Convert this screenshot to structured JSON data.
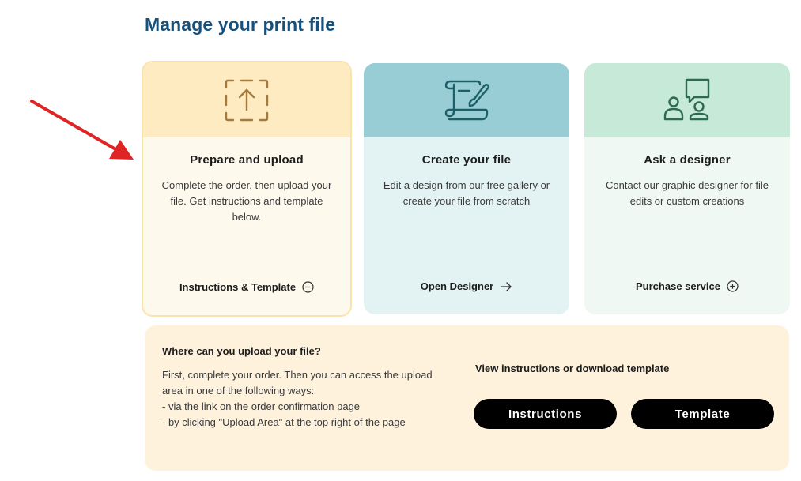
{
  "page": {
    "title": "Manage your print file"
  },
  "colors": {
    "title": "#17507a",
    "arrow": "#e02424",
    "prepare_icon": "#a57a3a",
    "create_icon": "#1d5f66",
    "ask_icon": "#2d6a4f"
  },
  "cards": {
    "prepare": {
      "icon": "upload-frame-icon",
      "title": "Prepare and upload",
      "description": "Complete the order, then upload your file. Get instructions and template below.",
      "link_label": "Instructions & Template",
      "link_icon": "minus-circle-icon"
    },
    "create": {
      "icon": "scroll-brush-icon",
      "title": "Create your file",
      "description": "Edit a design from our free gallery or create your file from scratch",
      "link_label": "Open Designer",
      "link_icon": "arrow-right-icon"
    },
    "ask": {
      "icon": "people-chat-icon",
      "title": "Ask a designer",
      "description": "Contact our graphic designer for file edits or custom creations",
      "link_label": "Purchase service",
      "link_icon": "plus-circle-icon"
    }
  },
  "info": {
    "heading": "Where can you upload your file?",
    "lines": [
      "First, complete your order. Then you can access the upload",
      "area in one of the following ways:",
      "- via the link on the order confirmation page",
      "- by clicking \"Upload Area\" at the top right of the page"
    ],
    "right_heading": "View instructions or download template",
    "buttons": {
      "instructions": "Instructions",
      "template": "Template"
    }
  }
}
